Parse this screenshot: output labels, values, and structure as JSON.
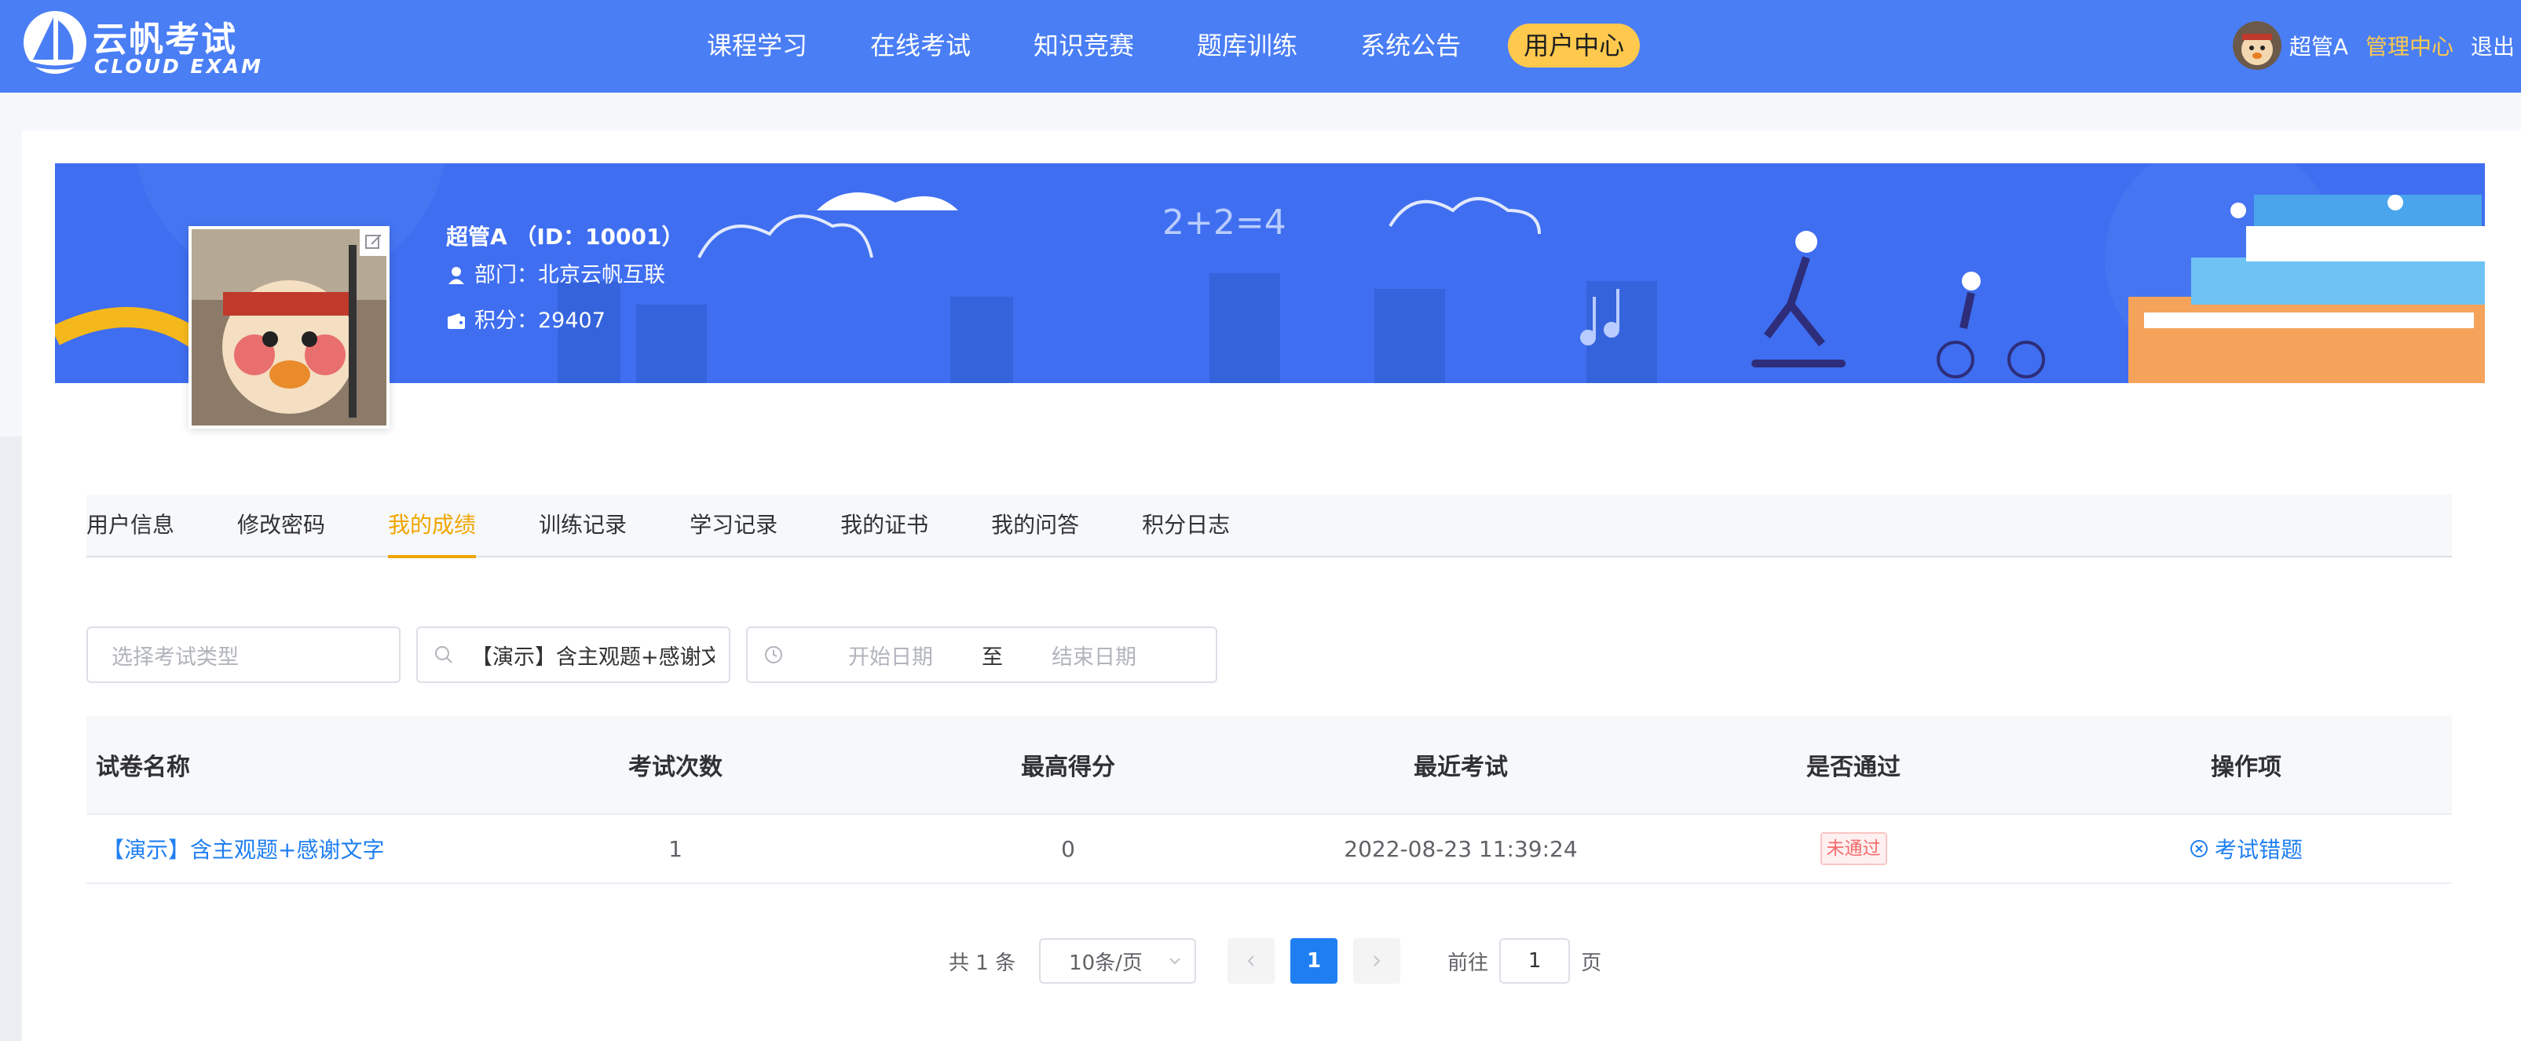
{
  "brand": {
    "name_cn": "云帆考试",
    "name_en": "CLOUD EXAM"
  },
  "nav": {
    "items": [
      {
        "label": "课程学习",
        "active": false
      },
      {
        "label": "在线考试",
        "active": false
      },
      {
        "label": "知识竞赛",
        "active": false
      },
      {
        "label": "题库训练",
        "active": false
      },
      {
        "label": "系统公告",
        "active": false
      },
      {
        "label": "用户中心",
        "active": true
      }
    ]
  },
  "user_menu": {
    "username": "超管A",
    "admin_label": "管理中心",
    "logout_label": "退出"
  },
  "profile": {
    "name_line": "超管A （ID：10001）",
    "department": "部门：北京云帆互联",
    "points": "积分：29407",
    "banner_text": "2+2=4"
  },
  "tabs": [
    {
      "label": "用户信息",
      "active": false
    },
    {
      "label": "修改密码",
      "active": false
    },
    {
      "label": "我的成绩",
      "active": true
    },
    {
      "label": "训练记录",
      "active": false
    },
    {
      "label": "学习记录",
      "active": false
    },
    {
      "label": "我的证书",
      "active": false
    },
    {
      "label": "我的问答",
      "active": false
    },
    {
      "label": "积分日志",
      "active": false
    }
  ],
  "filters": {
    "exam_type_placeholder": "选择考试类型",
    "search_value": "【演示】含主观题+感谢文字",
    "start_date_placeholder": "开始日期",
    "date_separator": "至",
    "end_date_placeholder": "结束日期"
  },
  "table": {
    "headers": [
      "试卷名称",
      "考试次数",
      "最高得分",
      "最近考试",
      "是否通过",
      "操作项"
    ],
    "rows": [
      {
        "paper_name": "【演示】含主观题+感谢文字",
        "attempts": "1",
        "max_score": "0",
        "last_exam": "2022-08-23 11:39:24",
        "passed": "未通过",
        "action": "考试错题"
      }
    ]
  },
  "pagination": {
    "total": "共 1 条",
    "page_size": "10条/页",
    "current_page": "1",
    "goto_label": "前往",
    "goto_value": "1",
    "page_suffix": "页"
  },
  "colors": {
    "primary": "#4a7ef5",
    "accent": "#ffc94d",
    "link": "#1f7ff2",
    "tab_active": "#f0a500",
    "fail": "#f56c6c"
  }
}
